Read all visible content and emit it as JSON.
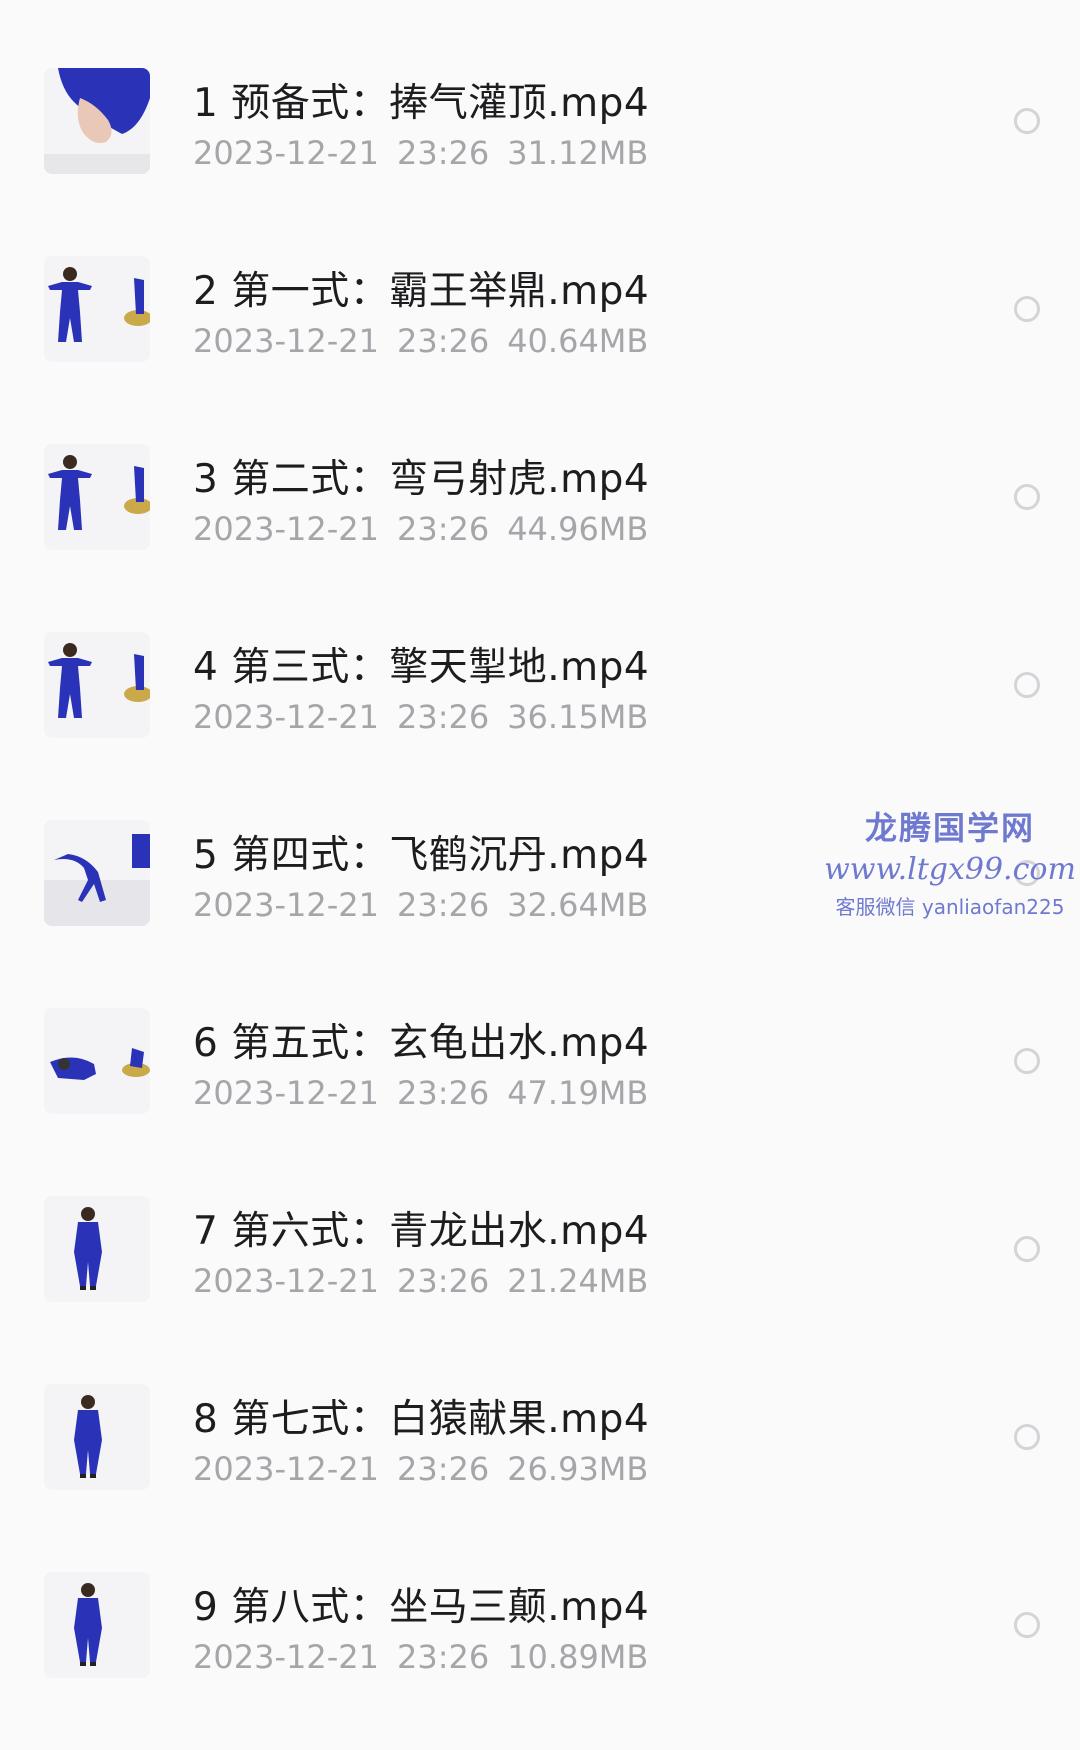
{
  "files": [
    {
      "name": "1 预备式：捧气灌顶.mp4",
      "date": "2023-12-21",
      "time": "23:26",
      "size": "31.12MB",
      "thumb": "hands"
    },
    {
      "name": "2 第一式：霸王举鼎.mp4",
      "date": "2023-12-21",
      "time": "23:26",
      "size": "40.64MB",
      "thumb": "figure-stance"
    },
    {
      "name": "3 第二式：弯弓射虎.mp4",
      "date": "2023-12-21",
      "time": "23:26",
      "size": "44.96MB",
      "thumb": "figure-stance"
    },
    {
      "name": "4 第三式：擎天掣地.mp4",
      "date": "2023-12-21",
      "time": "23:26",
      "size": "36.15MB",
      "thumb": "figure-stance"
    },
    {
      "name": "5 第四式：飞鹤沉丹.mp4",
      "date": "2023-12-21",
      "time": "23:26",
      "size": "32.64MB",
      "thumb": "figure-bend"
    },
    {
      "name": "6 第五式：玄龟出水.mp4",
      "date": "2023-12-21",
      "time": "23:26",
      "size": "47.19MB",
      "thumb": "figure-low"
    },
    {
      "name": "7 第六式：青龙出水.mp4",
      "date": "2023-12-21",
      "time": "23:26",
      "size": "21.24MB",
      "thumb": "figure-standing"
    },
    {
      "name": "8 第七式：白猿献果.mp4",
      "date": "2023-12-21",
      "time": "23:26",
      "size": "26.93MB",
      "thumb": "figure-standing"
    },
    {
      "name": "9 第八式：坐马三颠.mp4",
      "date": "2023-12-21",
      "time": "23:26",
      "size": "10.89MB",
      "thumb": "figure-standing"
    }
  ],
  "watermark": {
    "title": "龙腾国学网",
    "url": "www.ltgx99.com",
    "contact": "客服微信 yanliaofan225"
  },
  "colors": {
    "accent_figure": "#2a33b8",
    "name_text": "#1d1d1f",
    "meta_text": "#a6a6aa",
    "watermark": "#6f79cf"
  }
}
